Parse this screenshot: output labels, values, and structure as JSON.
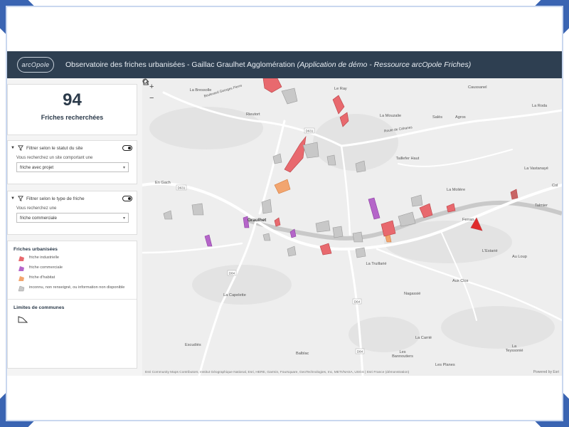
{
  "header": {
    "logo_text": "arcOpole",
    "title": "Observatoire des friches urbanisées - Gaillac Graulhet Agglomération",
    "title_italic": "(Application de démo - Ressource arcOpole Friches)",
    "bg_color": "#2e3f51"
  },
  "summary": {
    "count": "94",
    "label": "Friches recherchées"
  },
  "filters": [
    {
      "label": "Filtrer selon le statut du site",
      "question": "Vous recherchez un site comportant une",
      "value": "friche avec projet",
      "icon": "funnel-icon"
    },
    {
      "label": "Filtrer selon le type de friche",
      "question": "Vous recherchez une",
      "value": "friche commerciale",
      "icon": "funnel-icon"
    }
  ],
  "legend": {
    "title": "Friches urbanisées",
    "items": [
      {
        "label": "friche industrielle",
        "color": "#e8696e"
      },
      {
        "label": "friche commerciale",
        "color": "#b565c9"
      },
      {
        "label": "friche d'habitat",
        "color": "#f2a56f"
      },
      {
        "label": "inconnu, non renseigné, ou information non disponible",
        "color": "#c8c8c8"
      }
    ],
    "communes_title": "Limites de communes"
  },
  "map": {
    "labels": [
      {
        "text": "La Bressolle",
        "big": false
      },
      {
        "text": "Le Ray",
        "big": false
      },
      {
        "text": "Caussanel",
        "big": false
      },
      {
        "text": "Rieutort",
        "big": false
      },
      {
        "text": "La Mouzalie",
        "big": false
      },
      {
        "text": "Salès",
        "big": false
      },
      {
        "text": "Agros",
        "big": false
      },
      {
        "text": "La Roda",
        "big": false
      },
      {
        "text": "Taillefer Haut",
        "big": false
      },
      {
        "text": "La Vastanayé",
        "big": false
      },
      {
        "text": "En Gach",
        "big": false
      },
      {
        "text": "La Molière",
        "big": false
      },
      {
        "text": "Talmier",
        "big": false
      },
      {
        "text": "Graulhet",
        "big": true
      },
      {
        "text": "Ferran",
        "big": false
      },
      {
        "text": "L'Estarié",
        "big": false
      },
      {
        "text": "Au Loup",
        "big": false
      },
      {
        "text": "La Truillarié",
        "big": false
      },
      {
        "text": "Aux Clos",
        "big": false
      },
      {
        "text": "Nagassié",
        "big": false
      },
      {
        "text": "La Capelette",
        "big": false
      },
      {
        "text": "La Carrié",
        "big": false
      },
      {
        "text": "Escudiès",
        "big": false
      },
      {
        "text": "Balblac",
        "big": false
      },
      {
        "text": "Les Bannoutiers",
        "big": false
      },
      {
        "text": "Les Planes",
        "big": false
      },
      {
        "text": "La Teyssonié",
        "big": false
      },
      {
        "text": "Col",
        "big": false
      },
      {
        "text": "Boulevard Georges Pierre",
        "big": false
      },
      {
        "text": "Route de Cahanes",
        "big": false
      }
    ],
    "road_labels": [
      "D631",
      "D84",
      "D631",
      "D64",
      "D84"
    ],
    "attribution": "Esri Community Maps Contributors, Institut Géographique National, Esri, HERE, Garmin, Foursquare, GeoTechnologies, Inc, METI/NASA, USGS | Esri France (démonstration)",
    "powered": "Powered by Esri",
    "zoom_in": "+",
    "zoom_out": "−"
  }
}
